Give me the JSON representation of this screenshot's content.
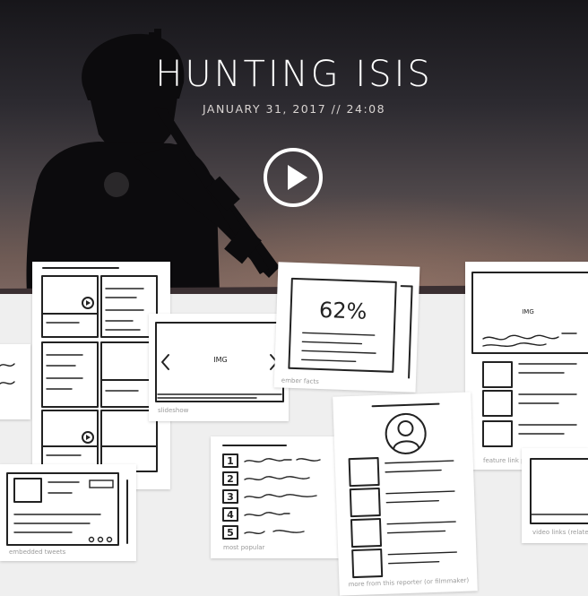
{
  "hero": {
    "title": "HUNTING ISIS",
    "meta": "JANUARY 31, 2017  //  24:08"
  },
  "cards": {
    "slideshow": {
      "label": "IMG",
      "caption": "slideshow"
    },
    "member_facts": {
      "value": "62%",
      "caption": "ember facts"
    },
    "feature": {
      "label": "IMG",
      "caption": "feature link p"
    },
    "tweets": {
      "caption": "embedded tweets"
    },
    "popular": {
      "numbers": [
        "1",
        "2",
        "3",
        "4",
        "5"
      ],
      "caption": "most popular"
    },
    "reporter": {
      "caption": "more from this reporter (or filmmaker)"
    },
    "video_links": {
      "caption": "video links (related, o"
    }
  },
  "colors": {
    "page_background": "#efefef",
    "hero_text": "#ffffff",
    "sketch_ink": "#222222",
    "caption_text": "#9a9a9a"
  },
  "icons": {
    "play": "play-icon",
    "slide_prev": "chevron-left-icon",
    "slide_next": "chevron-right-icon",
    "avatar": "user-avatar-icon"
  }
}
